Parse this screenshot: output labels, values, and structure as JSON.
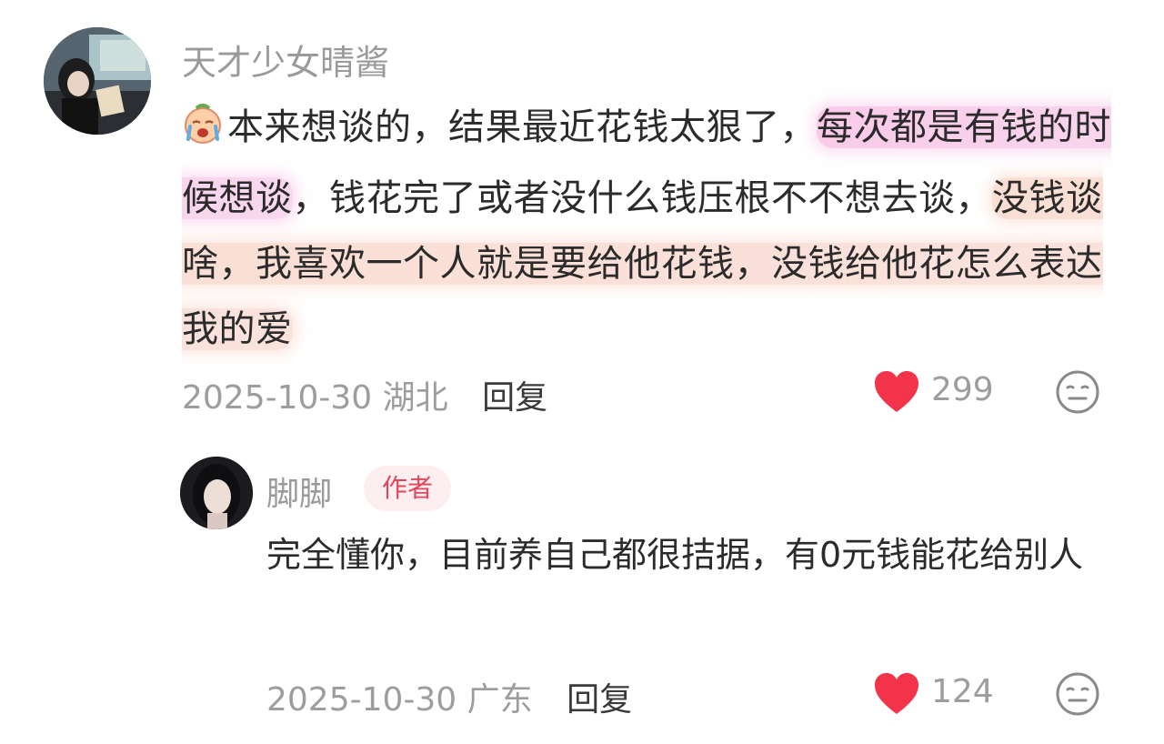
{
  "comment": {
    "username": "天才少女晴酱",
    "avatar_icon": "avatar-woman-reading",
    "emoji_icon": "crying-face-emoji",
    "segments": [
      {
        "text": "本来想谈的，结果最近花钱太狠了，",
        "style": "plain"
      },
      {
        "text": "每次都是有钱的时候想谈",
        "style": "pink"
      },
      {
        "text": "，钱花完了或者没什么钱压根不不想去谈，",
        "style": "plain"
      },
      {
        "text": "没钱谈啥，我喜欢一个人就是要给他花钱，没钱给他花怎么表达我的爱",
        "style": "peach"
      }
    ],
    "date": "2025-10-30",
    "location": "湖北",
    "reply_label": "回复",
    "likes": "299"
  },
  "reply": {
    "username": "脚脚",
    "badge": "作者",
    "avatar_icon": "avatar-woman-portrait",
    "text": "完全懂你，目前养自己都很拮据，有0元钱能花给别人",
    "date": "2025-10-30",
    "location": "广东",
    "reply_label": "回复",
    "likes": "124"
  },
  "colors": {
    "heart": "#f2334a",
    "badge_bg": "#fdeeef",
    "badge_text": "#e2455c",
    "meta_gray": "#9d9d9d",
    "highlight_pink": "#f4a0d6",
    "highlight_peach": "#f6c4b0"
  }
}
